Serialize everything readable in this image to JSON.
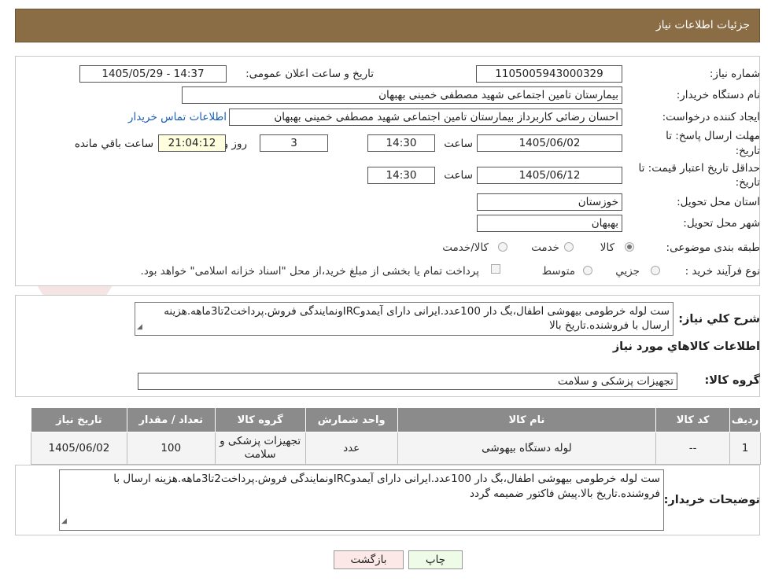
{
  "header": {
    "title": "جزئیات اطلاعات نیاز"
  },
  "watermark": {
    "text": "AriaTender.neT"
  },
  "form": {
    "need_number_label": "شماره نیاز:",
    "need_number": "1105005943000329",
    "announce_label": "تاریخ و ساعت اعلان عمومی:",
    "announce_value": "1405/05/29 - 14:37",
    "buyer_org_label": "نام دستگاه خریدار:",
    "buyer_org": "بیمارستان تامین اجتماعی شهید مصطفی خمینی بهبهان",
    "creator_label": "ایجاد کننده درخواست:",
    "creator": "احسان رضائی کاربرداز بیمارستان تامین اجتماعی شهید مصطفی خمینی بهبهان",
    "contact_link": "اطلاعات تماس خریدار",
    "deadline_label": "مهلت ارسال پاسخ: تا",
    "deadline_label2": "تاریخ:",
    "deadline_date": "1405/06/02",
    "time_label": "ساعت",
    "deadline_time": "14:30",
    "days": "3",
    "days_label": "روز و",
    "remaining": "21:04:12",
    "remaining_label": "ساعت باقي مانده",
    "validity_label": "حداقل تاریخ اعتبار قیمت: تا",
    "validity_label2": "تاریخ:",
    "validity_date": "1405/06/12",
    "validity_time": "14:30",
    "province_label": "استان محل تحویل:",
    "province": "خوزستان",
    "city_label": "شهر محل تحویل:",
    "city": "بهبهان",
    "category_label": "طبقه بندی موضوعی:",
    "category_options": [
      "کالا",
      "خدمت",
      "کالا/خدمت"
    ],
    "process_label": "نوع فرآیند خرید :",
    "process_options": [
      "جزیي",
      "متوسط"
    ],
    "payment_note": "پرداخت تمام یا بخشی از مبلغ خرید،از محل \"اسناد خزانه اسلامی\" خواهد بود."
  },
  "summary": {
    "label": "شرح کلي نياز:",
    "text": "ست لوله خرطومی بیهوشی اطفال،بگ دار 100عدد.ایرانی دارای آیمدوIRCونمایندگی فروش.پرداخت2تا3ماهه.هزینه ارسال با فروشنده.تاریخ بالا",
    "items_heading": "اطلاعات کالاهاي مورد نياز",
    "group_label": "گروه کالا:",
    "group_value": "تجهیزات پزشکی و سلامت"
  },
  "table": {
    "headers": [
      "ردیف",
      "کد کالا",
      "نام کالا",
      "واحد شمارش",
      "گروه کالا",
      "تعداد / مقدار",
      "تاریخ نیاز"
    ],
    "rows": [
      {
        "row": "1",
        "code": "--",
        "name": "لوله دستگاه بیهوشی",
        "unit": "عدد",
        "group": "تجهیزات پزشکی و سلامت",
        "qty": "100",
        "date": "1405/06/02"
      }
    ]
  },
  "buyer_notes": {
    "label": "توضیحات خریدار:",
    "text": "ست لوله خرطومی بیهوشی اطفال،بگ دار 100عدد.ایرانی دارای آیمدوIRCونمایندگی فروش.پرداخت2تا3ماهه.هزینه ارسال با فروشنده.تاریخ بالا.پیش فاکتور ضمیمه گردد"
  },
  "buttons": {
    "print": "چاپ",
    "back": "بازگشت"
  },
  "colors": {
    "header_bg": "#8b6d45",
    "table_header_bg": "#8b8b8b",
    "link": "#1a5fb4",
    "print_btn": "#eefbe6",
    "back_btn": "#fde8e8"
  }
}
